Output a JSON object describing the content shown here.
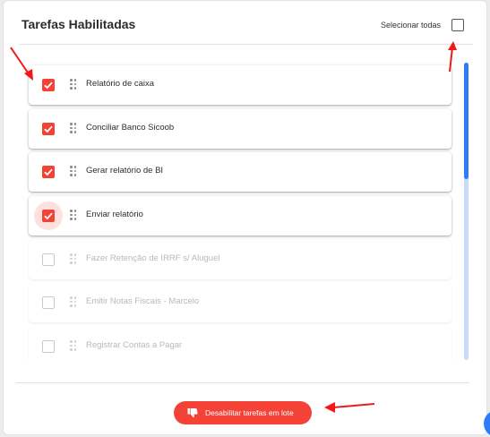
{
  "header": {
    "title": "Tarefas Habilitadas",
    "select_all_label": "Selecionar todas"
  },
  "tasks": [
    {
      "label": "Relatório de caixa",
      "checked": true
    },
    {
      "label": "Conciliar Banco Sicoob",
      "checked": true
    },
    {
      "label": "Gerar relatório de BI",
      "checked": true
    },
    {
      "label": "Enviar relatório",
      "checked": true
    },
    {
      "label": "Fazer Retenção de IRRF s/ Aluguel",
      "checked": false
    },
    {
      "label": "Emitir Notas Fiscais - Marcelo",
      "checked": false
    },
    {
      "label": "Registrar Contas a Pagar",
      "checked": false
    }
  ],
  "footer": {
    "button_label": "Desabilitar tarefas em lote",
    "button_icon": "thumbs-down-icon"
  },
  "colors": {
    "accent": "#f44336",
    "scroll": "#2f7cf6"
  }
}
